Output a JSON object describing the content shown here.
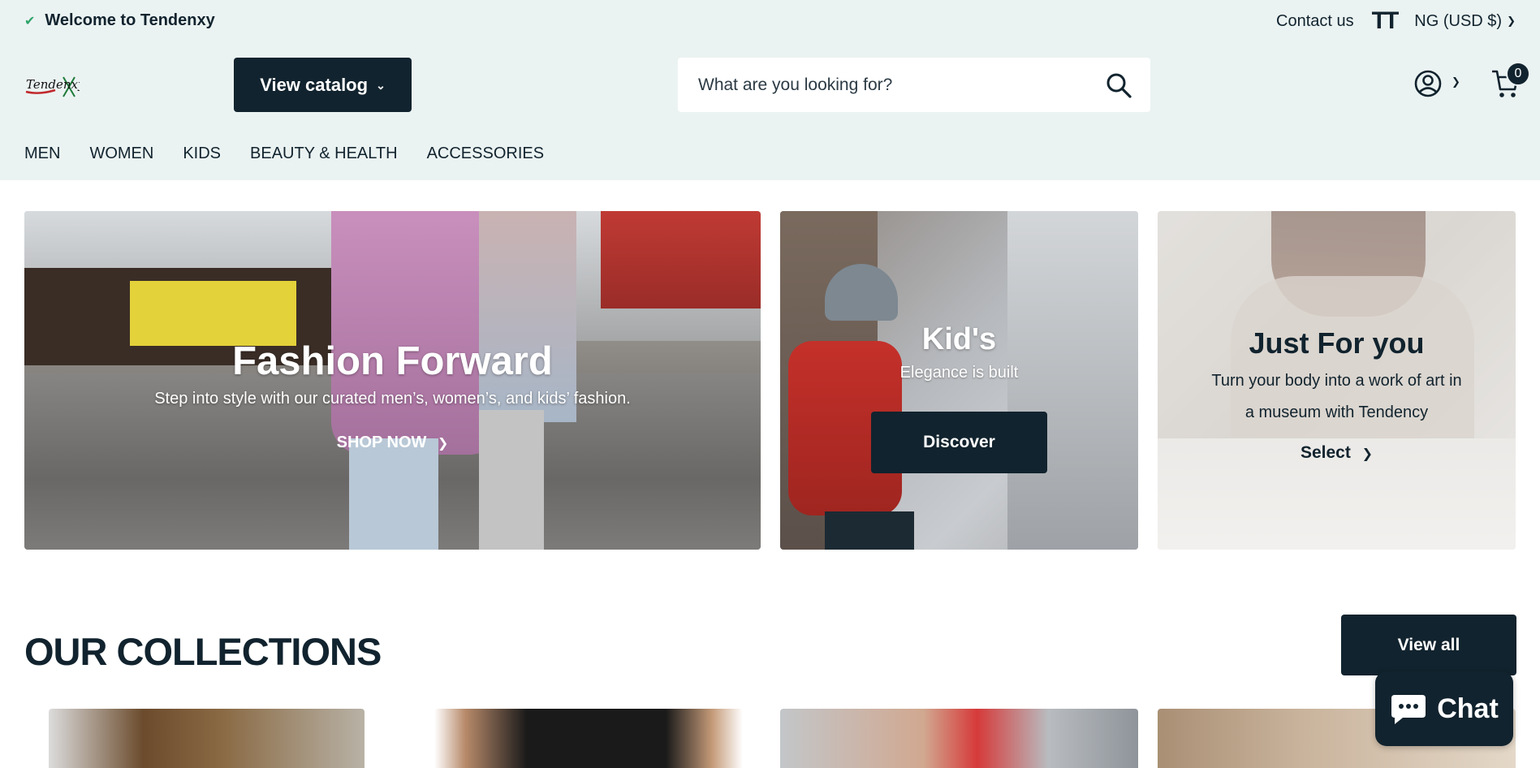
{
  "topbar": {
    "welcome": "Welcome to Tendenxy",
    "contact": "Contact us",
    "text_size_icon": "TT",
    "currency": "NG (USD $)"
  },
  "header": {
    "logo_text": "Tendenxy",
    "catalog_label": "View catalog",
    "search_placeholder": "What are you looking for?",
    "cart_count": "0"
  },
  "nav": {
    "items": [
      "MEN",
      "WOMEN",
      "KIDS",
      "BEAUTY & HEALTH",
      "ACCESSORIES"
    ]
  },
  "hero": {
    "main": {
      "title": "Fashion Forward",
      "subtitle": "Step into style with our curated men’s, women’s, and kids’ fashion.",
      "cta": "SHOP NOW"
    },
    "kids": {
      "title": "Kid's",
      "subtitle": "Elegance is built",
      "cta": "Discover"
    },
    "foryou": {
      "title": "Just For you",
      "subtitle": "Turn your body into a work of art in a museum with Tendency",
      "cta": "Select"
    }
  },
  "collections": {
    "title": "OUR COLLECTIONS",
    "view_all": "View all"
  },
  "chat": {
    "label": "Chat"
  },
  "colors": {
    "header_bg": "#ebf3f2",
    "primary": "#11232e",
    "check": "#2fa36b"
  }
}
